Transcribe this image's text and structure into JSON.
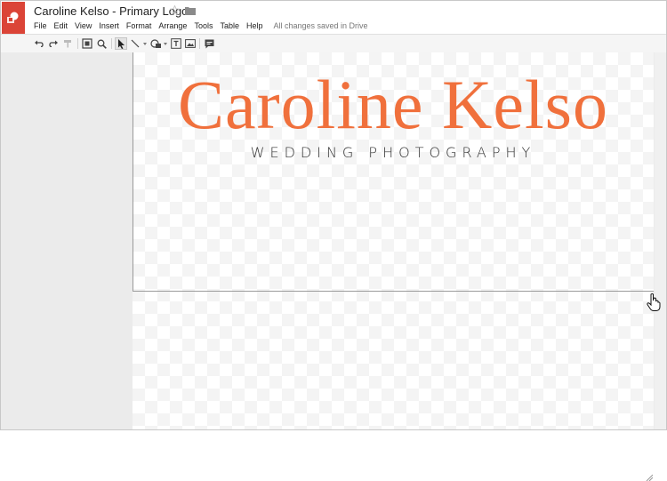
{
  "app": {
    "title": "Caroline Kelso - Primary Logo",
    "save_status": "All changes saved in Drive"
  },
  "menu": [
    "File",
    "Edit",
    "View",
    "Insert",
    "Format",
    "Arrange",
    "Tools",
    "Table",
    "Help"
  ],
  "toolbar": {
    "tools": [
      "undo",
      "redo",
      "paint-format",
      "zoom-fit",
      "zoom",
      "select",
      "line",
      "shape",
      "text-box",
      "image",
      "comment"
    ]
  },
  "canvas": {
    "logo_name": "Caroline Kelso",
    "logo_tagline": "WEDDING PHOTOGRAPHY",
    "logo_color": "#f0703c"
  }
}
